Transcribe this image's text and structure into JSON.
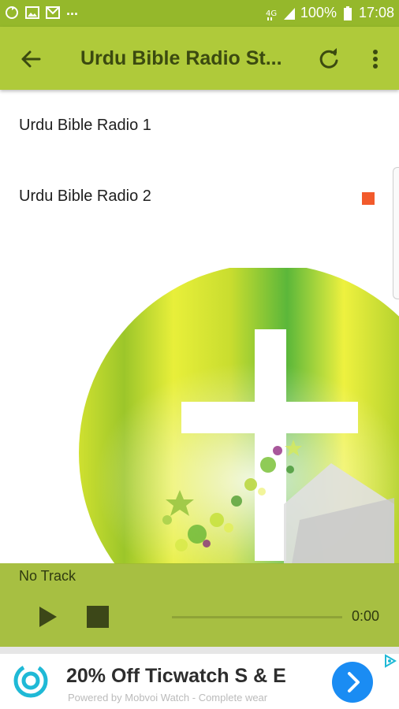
{
  "status_bar": {
    "overflow": "...",
    "battery": "100%",
    "time": "17:08",
    "icons": [
      "sync-icon",
      "image-icon",
      "mail-icon",
      "data-icon",
      "signal-icon",
      "battery-icon"
    ]
  },
  "app_bar": {
    "title": "Urdu Bible Radio St...",
    "back_icon": "arrow-back-icon",
    "refresh_icon": "refresh-icon",
    "more_icon": "more-vert-icon"
  },
  "stations": [
    {
      "label": "Urdu Bible Radio 1"
    },
    {
      "label": "Urdu Bible Radio 2"
    }
  ],
  "player": {
    "track": "No Track",
    "time": "0:00",
    "play_icon": "play-icon",
    "stop_icon": "stop-icon"
  },
  "ad": {
    "headline": "20% Off Ticwatch S & E",
    "subtext": "Powered by Mobvoi Watch - Complete wear",
    "cta_icon": "chevron-right-icon",
    "logo_icon": "ticwatch-logo-icon"
  },
  "colors": {
    "status_bar": "#95b82b",
    "app_bar": "#afca3a",
    "player": "#a0ba34",
    "accent": "#f25a2b",
    "ad_button": "#1a8cf3"
  }
}
